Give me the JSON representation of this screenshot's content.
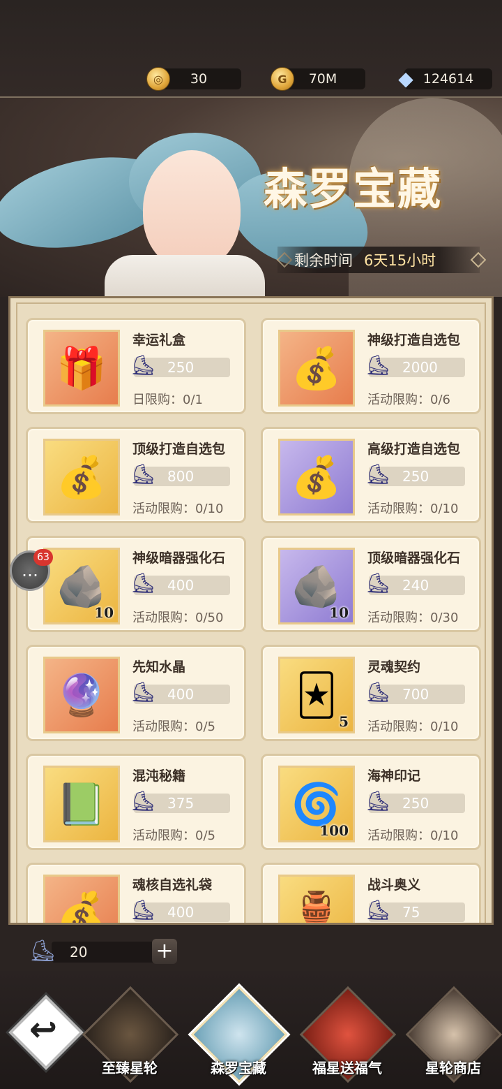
{
  "currencies": [
    {
      "icon": "gold-token-icon",
      "value": "30"
    },
    {
      "icon": "gold-coin-icon",
      "value": "70M"
    },
    {
      "icon": "diamond-icon",
      "value": "124614"
    }
  ],
  "banner": {
    "title": "森罗宝藏",
    "timer_label": "剩余时间",
    "timer_value": "6天15小时"
  },
  "items": [
    {
      "name": "幸运礼盒",
      "price": "250",
      "limit": "日限购：0/1",
      "art": "🎁",
      "bg": "orange",
      "qty": ""
    },
    {
      "name": "神级打造自选包",
      "price": "2000",
      "limit": "活动限购：0/6",
      "art": "💰",
      "bg": "orange",
      "qty": ""
    },
    {
      "name": "顶级打造自选包",
      "price": "800",
      "limit": "活动限购：0/10",
      "art": "💰",
      "bg": "gold",
      "qty": ""
    },
    {
      "name": "高级打造自选包",
      "price": "250",
      "limit": "活动限购：0/10",
      "art": "💰",
      "bg": "purple",
      "qty": ""
    },
    {
      "name": "神级暗器强化石",
      "price": "400",
      "limit": "活动限购：0/50",
      "art": "🪨",
      "bg": "gold",
      "qty": "10"
    },
    {
      "name": "顶级暗器强化石",
      "price": "240",
      "limit": "活动限购：0/30",
      "art": "🪨",
      "bg": "purple",
      "qty": "10"
    },
    {
      "name": "先知水晶",
      "price": "400",
      "limit": "活动限购：0/5",
      "art": "🔮",
      "bg": "orange",
      "qty": ""
    },
    {
      "name": "灵魂契约",
      "price": "700",
      "limit": "活动限购：0/10",
      "art": "🃏",
      "bg": "gold",
      "qty": "5"
    },
    {
      "name": "混沌秘籍",
      "price": "375",
      "limit": "活动限购：0/5",
      "art": "📗",
      "bg": "gold",
      "qty": ""
    },
    {
      "name": "海神印记",
      "price": "250",
      "limit": "活动限购：0/10",
      "art": "🌀",
      "bg": "gold",
      "qty": "100"
    },
    {
      "name": "魂核自选礼袋",
      "price": "400",
      "limit": "",
      "art": "💰",
      "bg": "orange",
      "qty": ""
    },
    {
      "name": "战斗奥义",
      "price": "75",
      "limit": "",
      "art": "🏺",
      "bg": "gold",
      "qty": ""
    }
  ],
  "counter": {
    "value": "20",
    "plus": "+"
  },
  "chat": {
    "badge": "63"
  },
  "nav": {
    "back_icon": "back-arrow-icon",
    "tabs": [
      {
        "label": "至臻星轮"
      },
      {
        "label": "森罗宝藏"
      },
      {
        "label": "福星送福气"
      },
      {
        "label": "星轮商店"
      }
    ]
  }
}
